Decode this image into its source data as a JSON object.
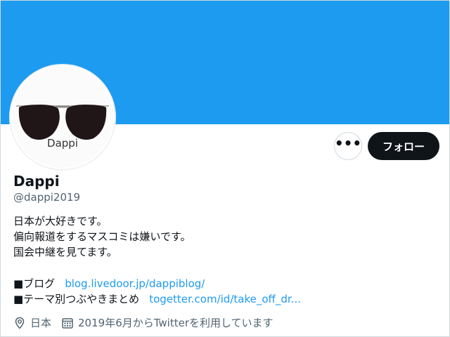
{
  "profile": {
    "avatar_text": "Dappi",
    "name": "Dappi",
    "handle": "@dappi2019",
    "bio_lines": [
      "日本が大好きです。",
      "偏向報道をするマスコミは嫌いです。",
      "国会中継を見てます。"
    ],
    "links": [
      {
        "label": "■ブログ",
        "url": "blog.livedoor.jp/dappiblog/"
      },
      {
        "label": "■テーマ別つぶやきまとめ",
        "url": "togetter.com/id/take_off_dr..."
      }
    ],
    "location": "日本",
    "joined": "2019年6月からTwitterを利用しています"
  },
  "actions": {
    "more_label": "•••",
    "follow_label": "フォロー"
  },
  "colors": {
    "banner": "#1d9bf0",
    "follow_button": "#0f1419",
    "link": "#1d9bf0",
    "secondary_text": "#536471"
  },
  "icons": {
    "location": "location-pin-icon",
    "joined": "calendar-icon",
    "more": "more-dots-icon"
  }
}
